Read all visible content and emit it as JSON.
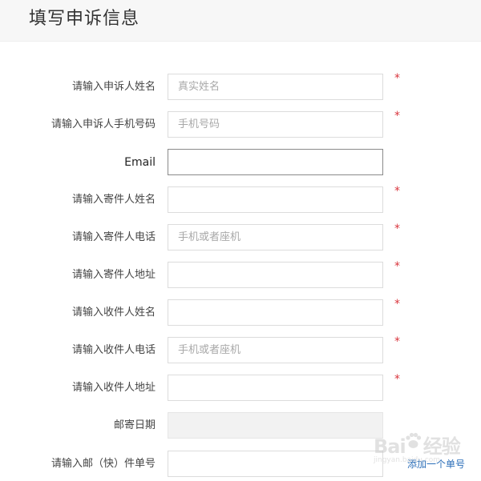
{
  "header": {
    "title": "填写申诉信息"
  },
  "form": {
    "rows": [
      {
        "label": "请输入申诉人姓名",
        "placeholder": "真实姓名",
        "value": "",
        "required": "*"
      },
      {
        "label": "请输入申诉人手机号码",
        "placeholder": "手机号码",
        "value": "",
        "required": "*"
      },
      {
        "label": "Email",
        "placeholder": "",
        "value": "",
        "required": ""
      },
      {
        "label": "请输入寄件人姓名",
        "placeholder": "",
        "value": "",
        "required": "*"
      },
      {
        "label": "请输入寄件人电话",
        "placeholder": "手机或者座机",
        "value": "",
        "required": "*"
      },
      {
        "label": "请输入寄件人地址",
        "placeholder": "",
        "value": "",
        "required": "*"
      },
      {
        "label": "请输入收件人姓名",
        "placeholder": "",
        "value": "",
        "required": "*"
      },
      {
        "label": "请输入收件人电话",
        "placeholder": "手机或者座机",
        "value": "",
        "required": "*"
      },
      {
        "label": "请输入收件人地址",
        "placeholder": "",
        "value": "",
        "required": "*"
      },
      {
        "label": "邮寄日期",
        "placeholder": "",
        "value": "",
        "required": ""
      },
      {
        "label": "请输入邮（快）件单号",
        "placeholder": "",
        "value": "",
        "required": ""
      }
    ],
    "add_tracking_link": "添加一个单号"
  },
  "watermark": {
    "brand": "Bai",
    "brand_suffix": "经验",
    "url": "jingyan.baidu.com"
  },
  "colors": {
    "required": "#d9363e",
    "link": "#2a6db8",
    "header_bg": "#f7f7f7"
  }
}
